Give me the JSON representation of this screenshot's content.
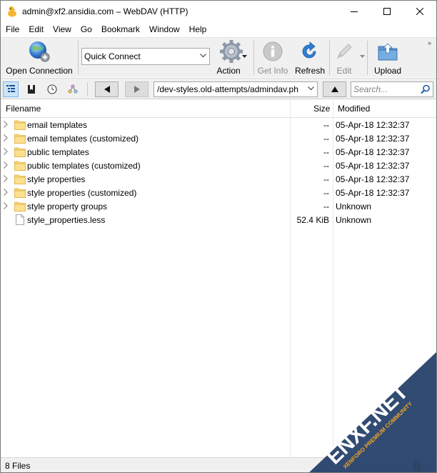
{
  "window": {
    "title": "admin@xf2.ansidia.com – WebDAV (HTTP)"
  },
  "menu": [
    "File",
    "Edit",
    "View",
    "Go",
    "Bookmark",
    "Window",
    "Help"
  ],
  "toolbar": {
    "open_connection": "Open Connection",
    "quick_connect": "Quick Connect",
    "action": "Action",
    "get_info": "Get Info",
    "refresh": "Refresh",
    "edit": "Edit",
    "upload": "Upload"
  },
  "nav": {
    "path": "/dev-styles.old-attempts/admindav.ph",
    "search_placeholder": "Search..."
  },
  "columns": {
    "filename": "Filename",
    "size": "Size",
    "modified": "Modified"
  },
  "files": [
    {
      "name": "email templates",
      "size": "--",
      "modified": "05-Apr-18 12:32:37",
      "type": "folder"
    },
    {
      "name": "email templates (customized)",
      "size": "--",
      "modified": "05-Apr-18 12:32:37",
      "type": "folder"
    },
    {
      "name": "public templates",
      "size": "--",
      "modified": "05-Apr-18 12:32:37",
      "type": "folder"
    },
    {
      "name": "public templates (customized)",
      "size": "--",
      "modified": "05-Apr-18 12:32:37",
      "type": "folder"
    },
    {
      "name": "style properties",
      "size": "--",
      "modified": "05-Apr-18 12:32:37",
      "type": "folder"
    },
    {
      "name": "style properties (customized)",
      "size": "--",
      "modified": "05-Apr-18 12:32:37",
      "type": "folder"
    },
    {
      "name": "style property groups",
      "size": "--",
      "modified": "Unknown",
      "type": "folder"
    },
    {
      "name": "style_properties.less",
      "size": "52.4 KiB",
      "modified": "Unknown",
      "type": "file"
    }
  ],
  "status": {
    "text": "8 Files"
  },
  "watermark": {
    "brand": "ENXF.NET",
    "tagline": "XENFORO PREMIUM COMMUNITY"
  },
  "colors": {
    "folder": "#f8d775",
    "selection": "#cce4f7",
    "watermark_bg": "#1f3c66",
    "watermark_accent": "#f5a623"
  }
}
